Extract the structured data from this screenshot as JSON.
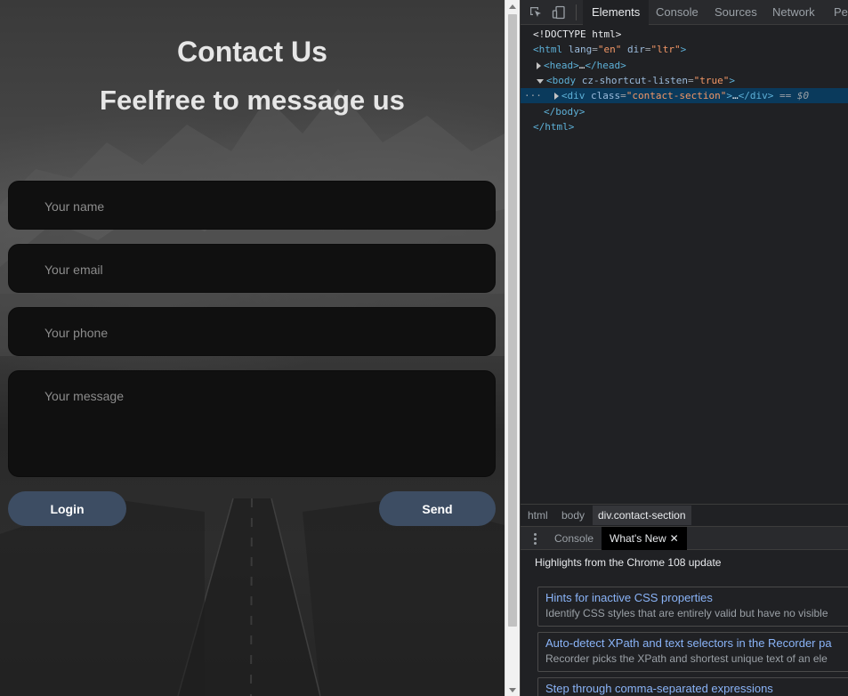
{
  "page": {
    "title": "Contact Us",
    "subtitle": "Feelfree to message us",
    "fields": {
      "name_placeholder": "Your name",
      "email_placeholder": "Your email",
      "phone_placeholder": "Your phone",
      "message_placeholder": "Your message"
    },
    "buttons": {
      "login": "Login",
      "send": "Send"
    },
    "colors": {
      "button_bg": "#3d4d63",
      "field_bg": "#101010"
    }
  },
  "devtools": {
    "tabs": [
      "Elements",
      "Console",
      "Sources",
      "Network",
      "Per"
    ],
    "active_tab": "Elements",
    "dom": {
      "doctype": "<!DOCTYPE html>",
      "html_open": "<html",
      "lang_attr": "lang",
      "lang_val": "\"en\"",
      "dir_attr": "dir",
      "dir_val": "\"ltr\"",
      "html_open_end": ">",
      "head": "<head>",
      "head_ellipsis": "…",
      "head_close": "</head>",
      "body_open": "<body",
      "body_attr": "cz-shortcut-listen",
      "body_attr_val": "\"true\"",
      "body_open_end": ">",
      "div_open": "<div",
      "div_attr": "class",
      "div_attr_val": "\"contact-section\"",
      "div_open_end": ">",
      "div_ellipsis": "…",
      "div_close": "</div>",
      "selected_marker": "== $0",
      "row_dots": "···",
      "body_close": "</body>",
      "html_close": "</html>"
    },
    "breadcrumbs": [
      "html",
      "body",
      "div.contact-section"
    ],
    "drawer": {
      "tabs": [
        "Console",
        "What's New"
      ],
      "active": "What's New",
      "close_glyph": "✕"
    },
    "whats_new": {
      "heading": "Highlights from the Chrome 108 update",
      "items": [
        {
          "title": "Hints for inactive CSS properties",
          "desc": "Identify CSS styles that are entirely valid but have no visible"
        },
        {
          "title": "Auto-detect XPath and text selectors in the Recorder pa",
          "desc": "Recorder picks the XPath and shortest unique text of an ele"
        },
        {
          "title": "Step through comma-separated expressions",
          "desc": ""
        }
      ]
    }
  },
  "icons": [
    "inspect-element-icon",
    "device-toolbar-icon",
    "kebab-menu-icon",
    "close-icon",
    "expand-triangle-icon"
  ]
}
